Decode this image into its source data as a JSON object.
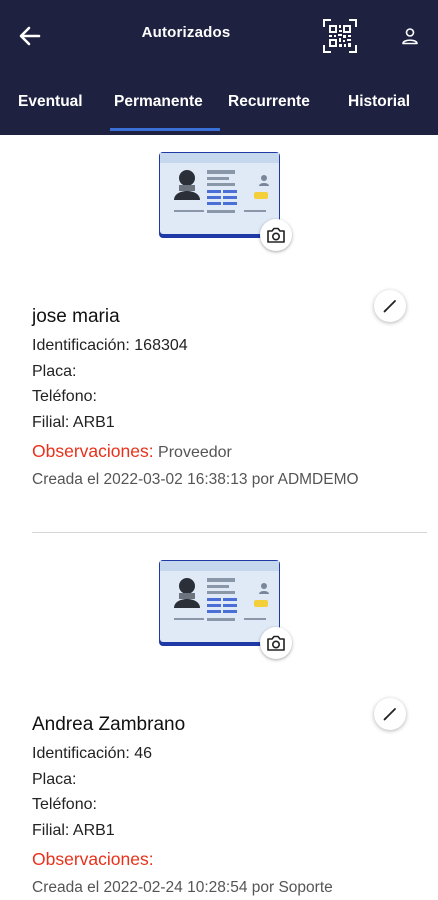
{
  "header": {
    "title": "Autorizados",
    "back_icon": "arrow-left-icon",
    "qr_icon": "qr-code-icon",
    "user_icon": "user-icon"
  },
  "tabs": [
    {
      "label": "Eventual"
    },
    {
      "label": "Permanente",
      "active": true
    },
    {
      "label": "Recurrente"
    },
    {
      "label": "Historial"
    }
  ],
  "records": [
    {
      "name": "jose maria",
      "identification": "Identificación: 168304",
      "plate": "Placa:",
      "phone": "Teléfono:",
      "branch": "Filial: ARB1",
      "observations_label": "Observaciones:",
      "observations_value": "Proveedor",
      "created": "Creada el 2022-03-02 16:38:13 por ADMDEMO"
    },
    {
      "name": "Andrea Zambrano",
      "identification": "Identificación: 46",
      "plate": "Placa:",
      "phone": "Teléfono:",
      "branch": "Filial: ARB1",
      "observations_label": "Observaciones:",
      "observations_value": "",
      "created": "Creada el 2022-02-24 10:28:54 por Soporte"
    }
  ],
  "colors": {
    "appbar": "#1e2140",
    "tab_indicator": "#3b6fd8",
    "observations": "#e8311a"
  }
}
